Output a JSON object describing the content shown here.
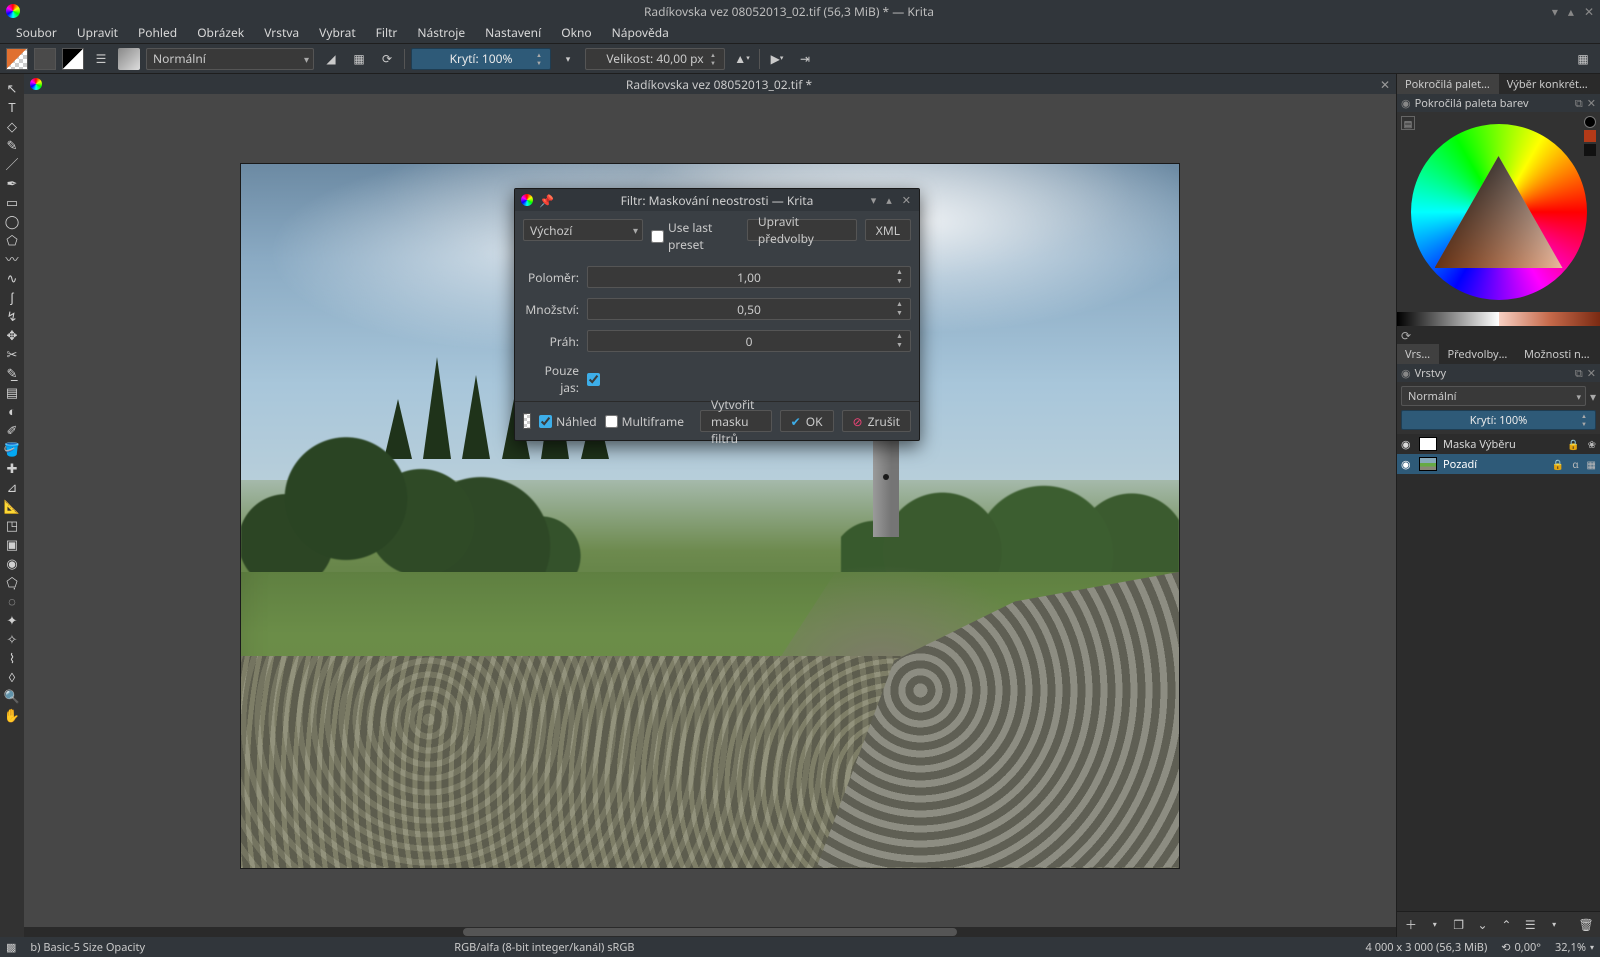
{
  "titlebar": {
    "title": "Radíkovska vez 08052013_02.tif (56,3 MiB) * — Krita"
  },
  "menu": {
    "soubor": "Soubor",
    "upravit": "Upravit",
    "pohled": "Pohled",
    "obrazek": "Obrázek",
    "vrstva": "Vrstva",
    "vybrat": "Vybrat",
    "filtr": "Filtr",
    "nastroje": "Nástroje",
    "nastaveni": "Nastavení",
    "okno": "Okno",
    "napoveda": "Nápověda"
  },
  "toolbar": {
    "blendmode": "Normální",
    "opacity": "Krytí: 100%",
    "size": "Velikost: 40,00 px"
  },
  "doc": {
    "tab_title": "Radíkovska vez 08052013_02.tif *"
  },
  "right": {
    "tab_palette": "Pokročilá paleta barev",
    "tab_specific": "Výběr konkrétní barvy",
    "header_palette": "Pokročilá paleta barev",
    "tab_layers": "Vrstvy",
    "tab_brushpresets": "Předvolby št…",
    "tab_tooloptions": "Možnosti nást…",
    "header_layers": "Vrstvy",
    "layer_blend": "Normální",
    "layer_opacity": "Krytí: 100%",
    "layers": [
      {
        "name": "Maska Výběru"
      },
      {
        "name": "Pozadí"
      }
    ]
  },
  "dialog": {
    "title": "Filtr: Maskování neostrosti — Krita",
    "preset": "Výchozí",
    "use_last": "Use last preset",
    "edit_presets": "Upravit předvolby",
    "xml": "XML",
    "radius_lbl": "Poloměr:",
    "radius_val": "1,00",
    "amount_lbl": "Množství:",
    "amount_val": "0,50",
    "threshold_lbl": "Práh:",
    "threshold_val": "0",
    "lightness_lbl": "Pouze jas:",
    "preview": "Náhled",
    "multiframe": "Multiframe",
    "create_mask": "Vytvořit masku filtrů",
    "ok": "OK",
    "cancel": "Zrušit"
  },
  "status": {
    "brush": "b) Basic-5 Size Opacity",
    "colorspace": "RGB/alfa (8-bit integer/kanál)  sRGB",
    "dimensions": "4 000 x 3 000 (56,3 MiB)",
    "angle": "0,00°",
    "zoom": "32,1%"
  }
}
